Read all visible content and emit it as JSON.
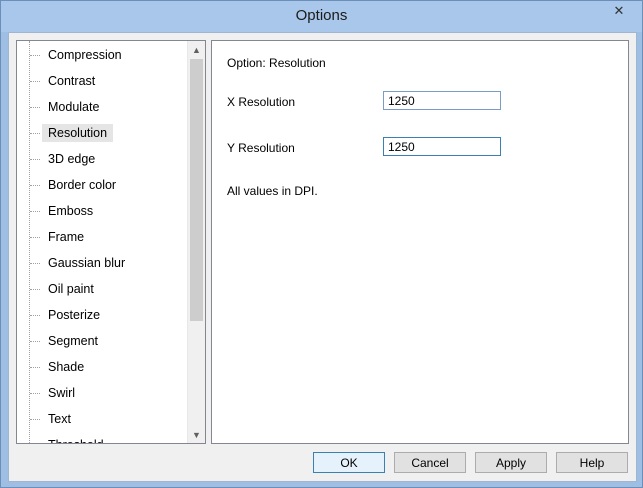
{
  "window": {
    "title": "Options",
    "close_glyph": "✕"
  },
  "tree": {
    "items": [
      {
        "label": "Compression"
      },
      {
        "label": "Contrast"
      },
      {
        "label": "Modulate"
      },
      {
        "label": "Resolution",
        "selected": true
      },
      {
        "label": "3D edge"
      },
      {
        "label": "Border color"
      },
      {
        "label": "Emboss"
      },
      {
        "label": "Frame"
      },
      {
        "label": "Gaussian blur"
      },
      {
        "label": "Oil paint"
      },
      {
        "label": "Posterize"
      },
      {
        "label": "Segment"
      },
      {
        "label": "Shade"
      },
      {
        "label": "Swirl"
      },
      {
        "label": "Text"
      },
      {
        "label": "Threshold"
      }
    ],
    "scroll_up_icon": "▲",
    "scroll_down_icon": "▼"
  },
  "panel": {
    "heading": "Option: Resolution",
    "x_label": "X Resolution",
    "x_value": "1250",
    "y_label": "Y Resolution",
    "y_value": "1250",
    "note": "All values in DPI."
  },
  "buttons": {
    "ok": "OK",
    "cancel": "Cancel",
    "apply": "Apply",
    "help": "Help"
  }
}
